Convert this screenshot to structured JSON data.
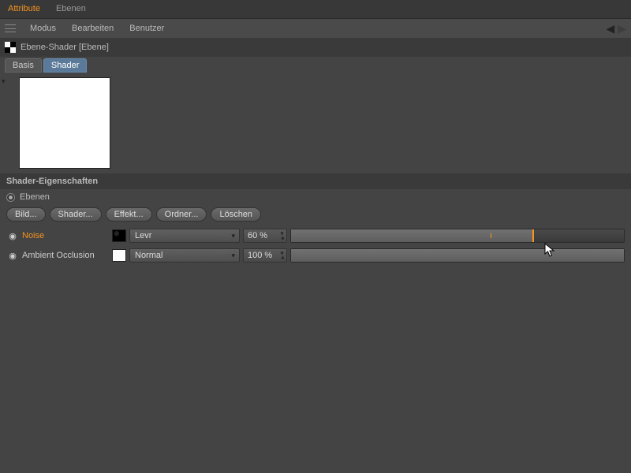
{
  "tabs": {
    "attribute": "Attribute",
    "ebenen": "Ebenen"
  },
  "menu": {
    "modus": "Modus",
    "bearbeiten": "Bearbeiten",
    "benutzer": "Benutzer"
  },
  "object": {
    "title": "Ebene-Shader [Ebene]"
  },
  "modeTabs": {
    "basis": "Basis",
    "shader": "Shader"
  },
  "section": {
    "title": "Shader-Eigenschaften"
  },
  "radio": {
    "ebenen": "Ebenen"
  },
  "buttons": {
    "bild": "Bild...",
    "shader": "Shader...",
    "effekt": "Effekt...",
    "ordner": "Ordner...",
    "loeschen": "Löschen"
  },
  "layers": [
    {
      "name": "Noise",
      "selected": true,
      "blend": "Levr",
      "value": "60 %",
      "fill_pct": 73,
      "tick_pct": 60
    },
    {
      "name": "Ambient Occlusion",
      "selected": false,
      "blend": "Normal",
      "value": "100 %",
      "fill_pct": 100,
      "tick_pct": null
    }
  ]
}
